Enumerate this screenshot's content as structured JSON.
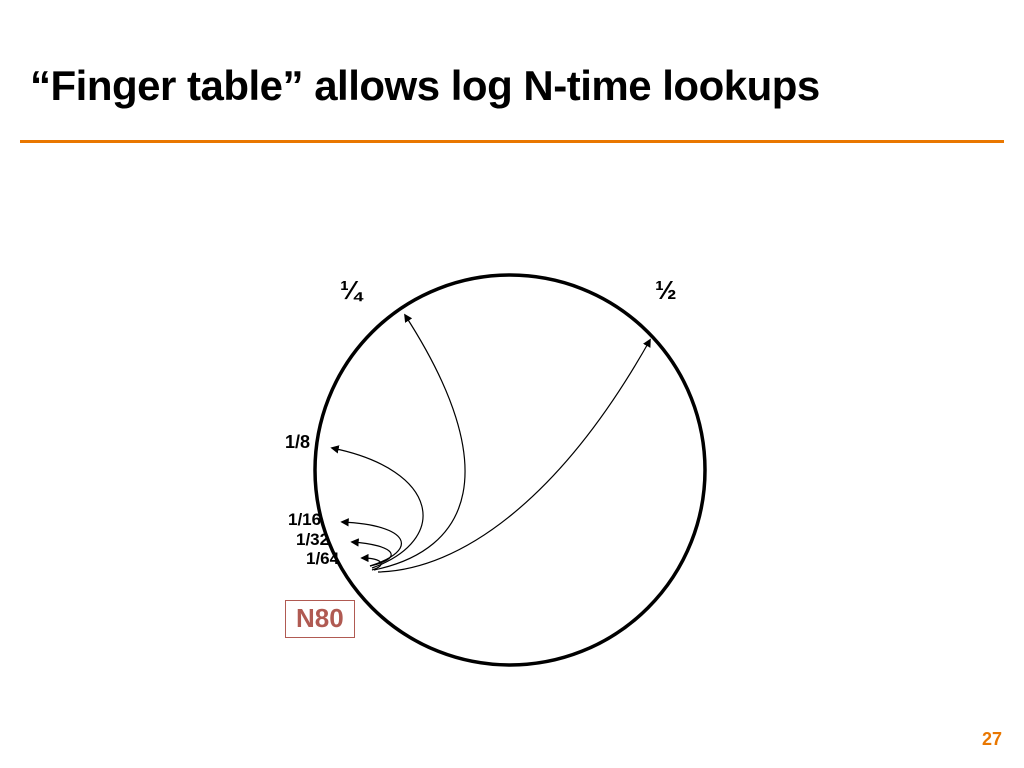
{
  "title": "“Finger table” allows log N-time lookups",
  "node_label": "N80",
  "fractions": {
    "half": "½",
    "quarter": "¼",
    "eighth": "1/8",
    "sixteenth": "1/16",
    "thirty_second": "1/32",
    "sixty_fourth": "1/64"
  },
  "page_number": "27",
  "colors": {
    "accent": "#e97700",
    "node": "#b05a52"
  }
}
